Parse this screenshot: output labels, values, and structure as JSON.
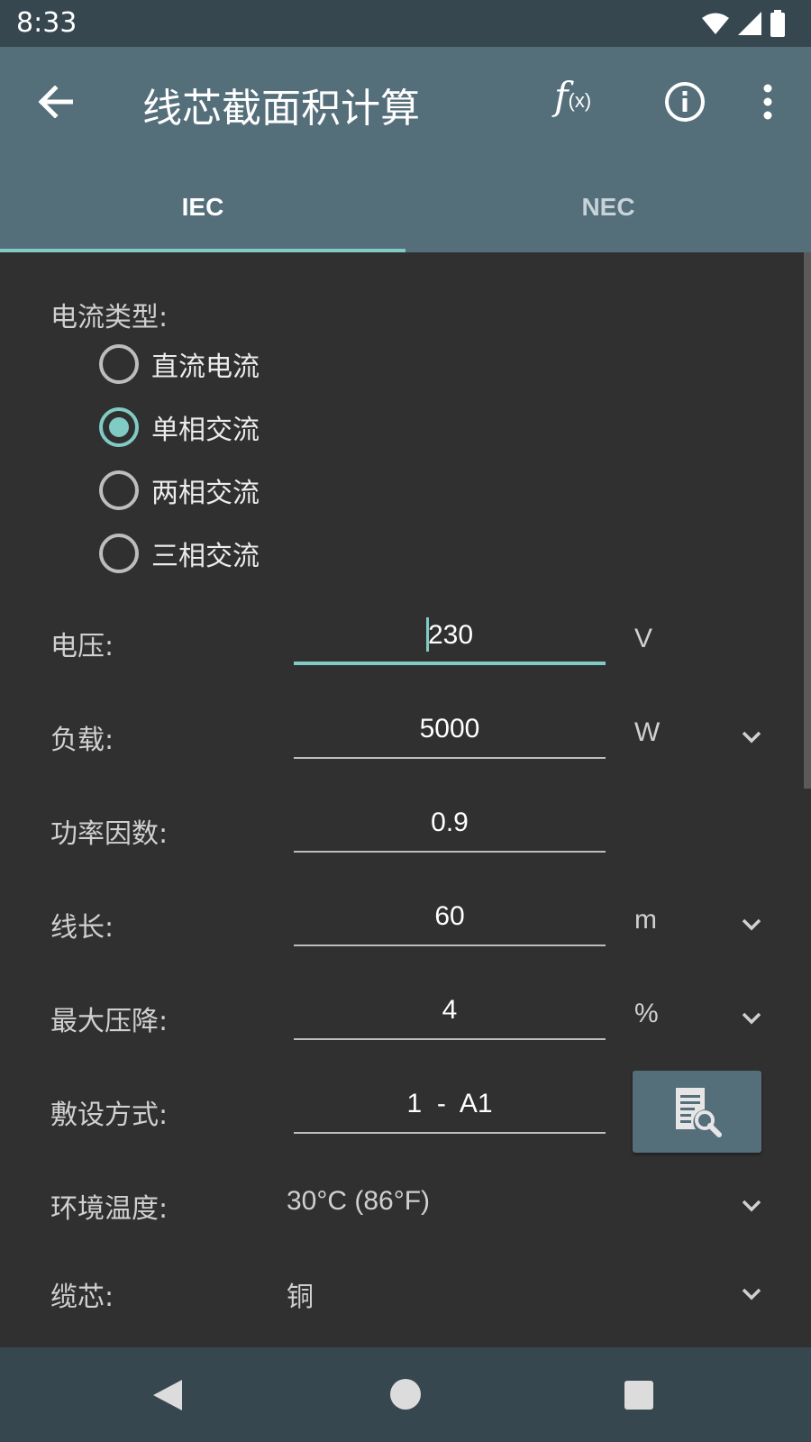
{
  "status_bar": {
    "time": "8:33"
  },
  "appbar": {
    "title": "线芯截面积计算",
    "fx_f": "f",
    "fx_x": "(x)"
  },
  "tabs": [
    {
      "label": "IEC",
      "active": true
    },
    {
      "label": "NEC",
      "active": false
    }
  ],
  "current_type": {
    "label": "电流类型:",
    "options": [
      "直流电流",
      "单相交流",
      "两相交流",
      "三相交流"
    ],
    "selected": "单相交流"
  },
  "fields": {
    "voltage": {
      "label": "电压:",
      "value": "230",
      "unit": "V"
    },
    "load": {
      "label": "负载:",
      "value": "5000",
      "unit": "W"
    },
    "power_factor": {
      "label": "功率因数:",
      "value": "0.9"
    },
    "length": {
      "label": "线长:",
      "value": "60",
      "unit": "m"
    },
    "max_drop": {
      "label": "最大压降:",
      "value": "4",
      "unit": "%"
    },
    "install_method": {
      "label": "敷设方式:",
      "value": "1  -  A1"
    },
    "ambient_temp": {
      "label": "环境温度:",
      "value": "30°C (86°F)"
    },
    "conductor": {
      "label": "缆芯:",
      "value": "铜"
    }
  },
  "colors": {
    "accent": "#80cbc4",
    "appbar": "#546e7a",
    "status_bar": "#37474f",
    "background": "#303030"
  },
  "icons": [
    "back-arrow-icon",
    "function-icon",
    "info-icon",
    "more-vert-icon",
    "chevron-down-icon",
    "table-search-icon",
    "wifi-icon",
    "signal-icon",
    "battery-icon"
  ]
}
